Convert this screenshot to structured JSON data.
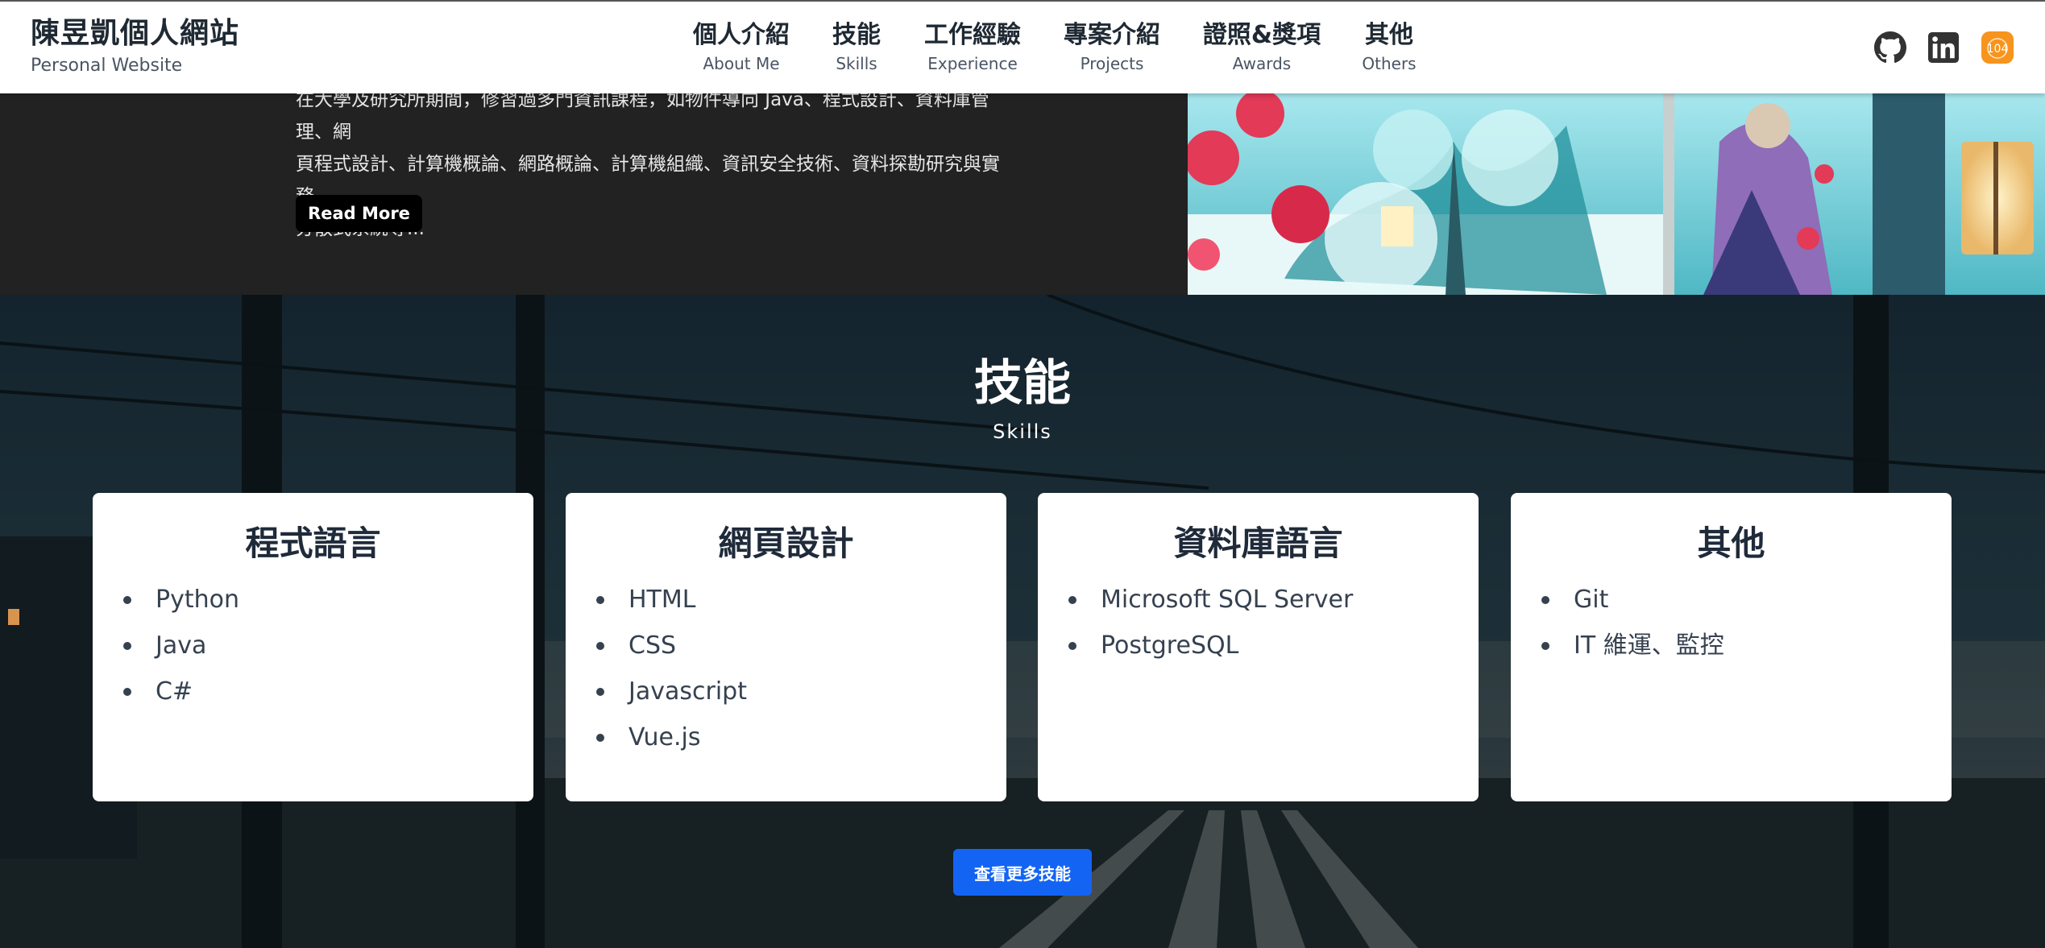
{
  "header": {
    "brand_title": "陳昱凱個人網站",
    "brand_subtitle": "Personal Website",
    "nav": [
      {
        "zh": "個人介紹",
        "en": "About Me"
      },
      {
        "zh": "技能",
        "en": "Skills"
      },
      {
        "zh": "工作經驗",
        "en": "Experience"
      },
      {
        "zh": "專案介紹",
        "en": "Projects"
      },
      {
        "zh": "證照&獎項",
        "en": "Awards"
      },
      {
        "zh": "其他",
        "en": "Others"
      }
    ],
    "social": {
      "github": "github-icon",
      "linkedin": "linkedin-icon",
      "job104_label": "104"
    }
  },
  "about": {
    "line1": "在大學及研究所期間，修習過多門資訊課程，如物件導向 Java、程式設計、資料庫管理、網",
    "line2": "頁程式設計、計算機概論、網路概論、計算機組織、資訊安全技術、資料探勘研究與實務、",
    "line3": "分散式系統等...",
    "read_more": "Read More"
  },
  "skills": {
    "title": "技能",
    "subtitle": "Skills",
    "cards": [
      {
        "title": "程式語言",
        "items": [
          "Python",
          "Java",
          "C#"
        ]
      },
      {
        "title": "網頁設計",
        "items": [
          "HTML",
          "CSS",
          "Javascript",
          "Vue.js"
        ]
      },
      {
        "title": "資料庫語言",
        "items": [
          "Microsoft SQL Server",
          "PostgreSQL"
        ]
      },
      {
        "title": "其他",
        "items": [
          "Git",
          "IT 維運、監控"
        ]
      }
    ],
    "more_button": "查看更多技能"
  },
  "colors": {
    "accent": "#1464f4",
    "header_bg": "#ffffff",
    "about_bg": "#222222",
    "badge_104": "#f7941d"
  }
}
